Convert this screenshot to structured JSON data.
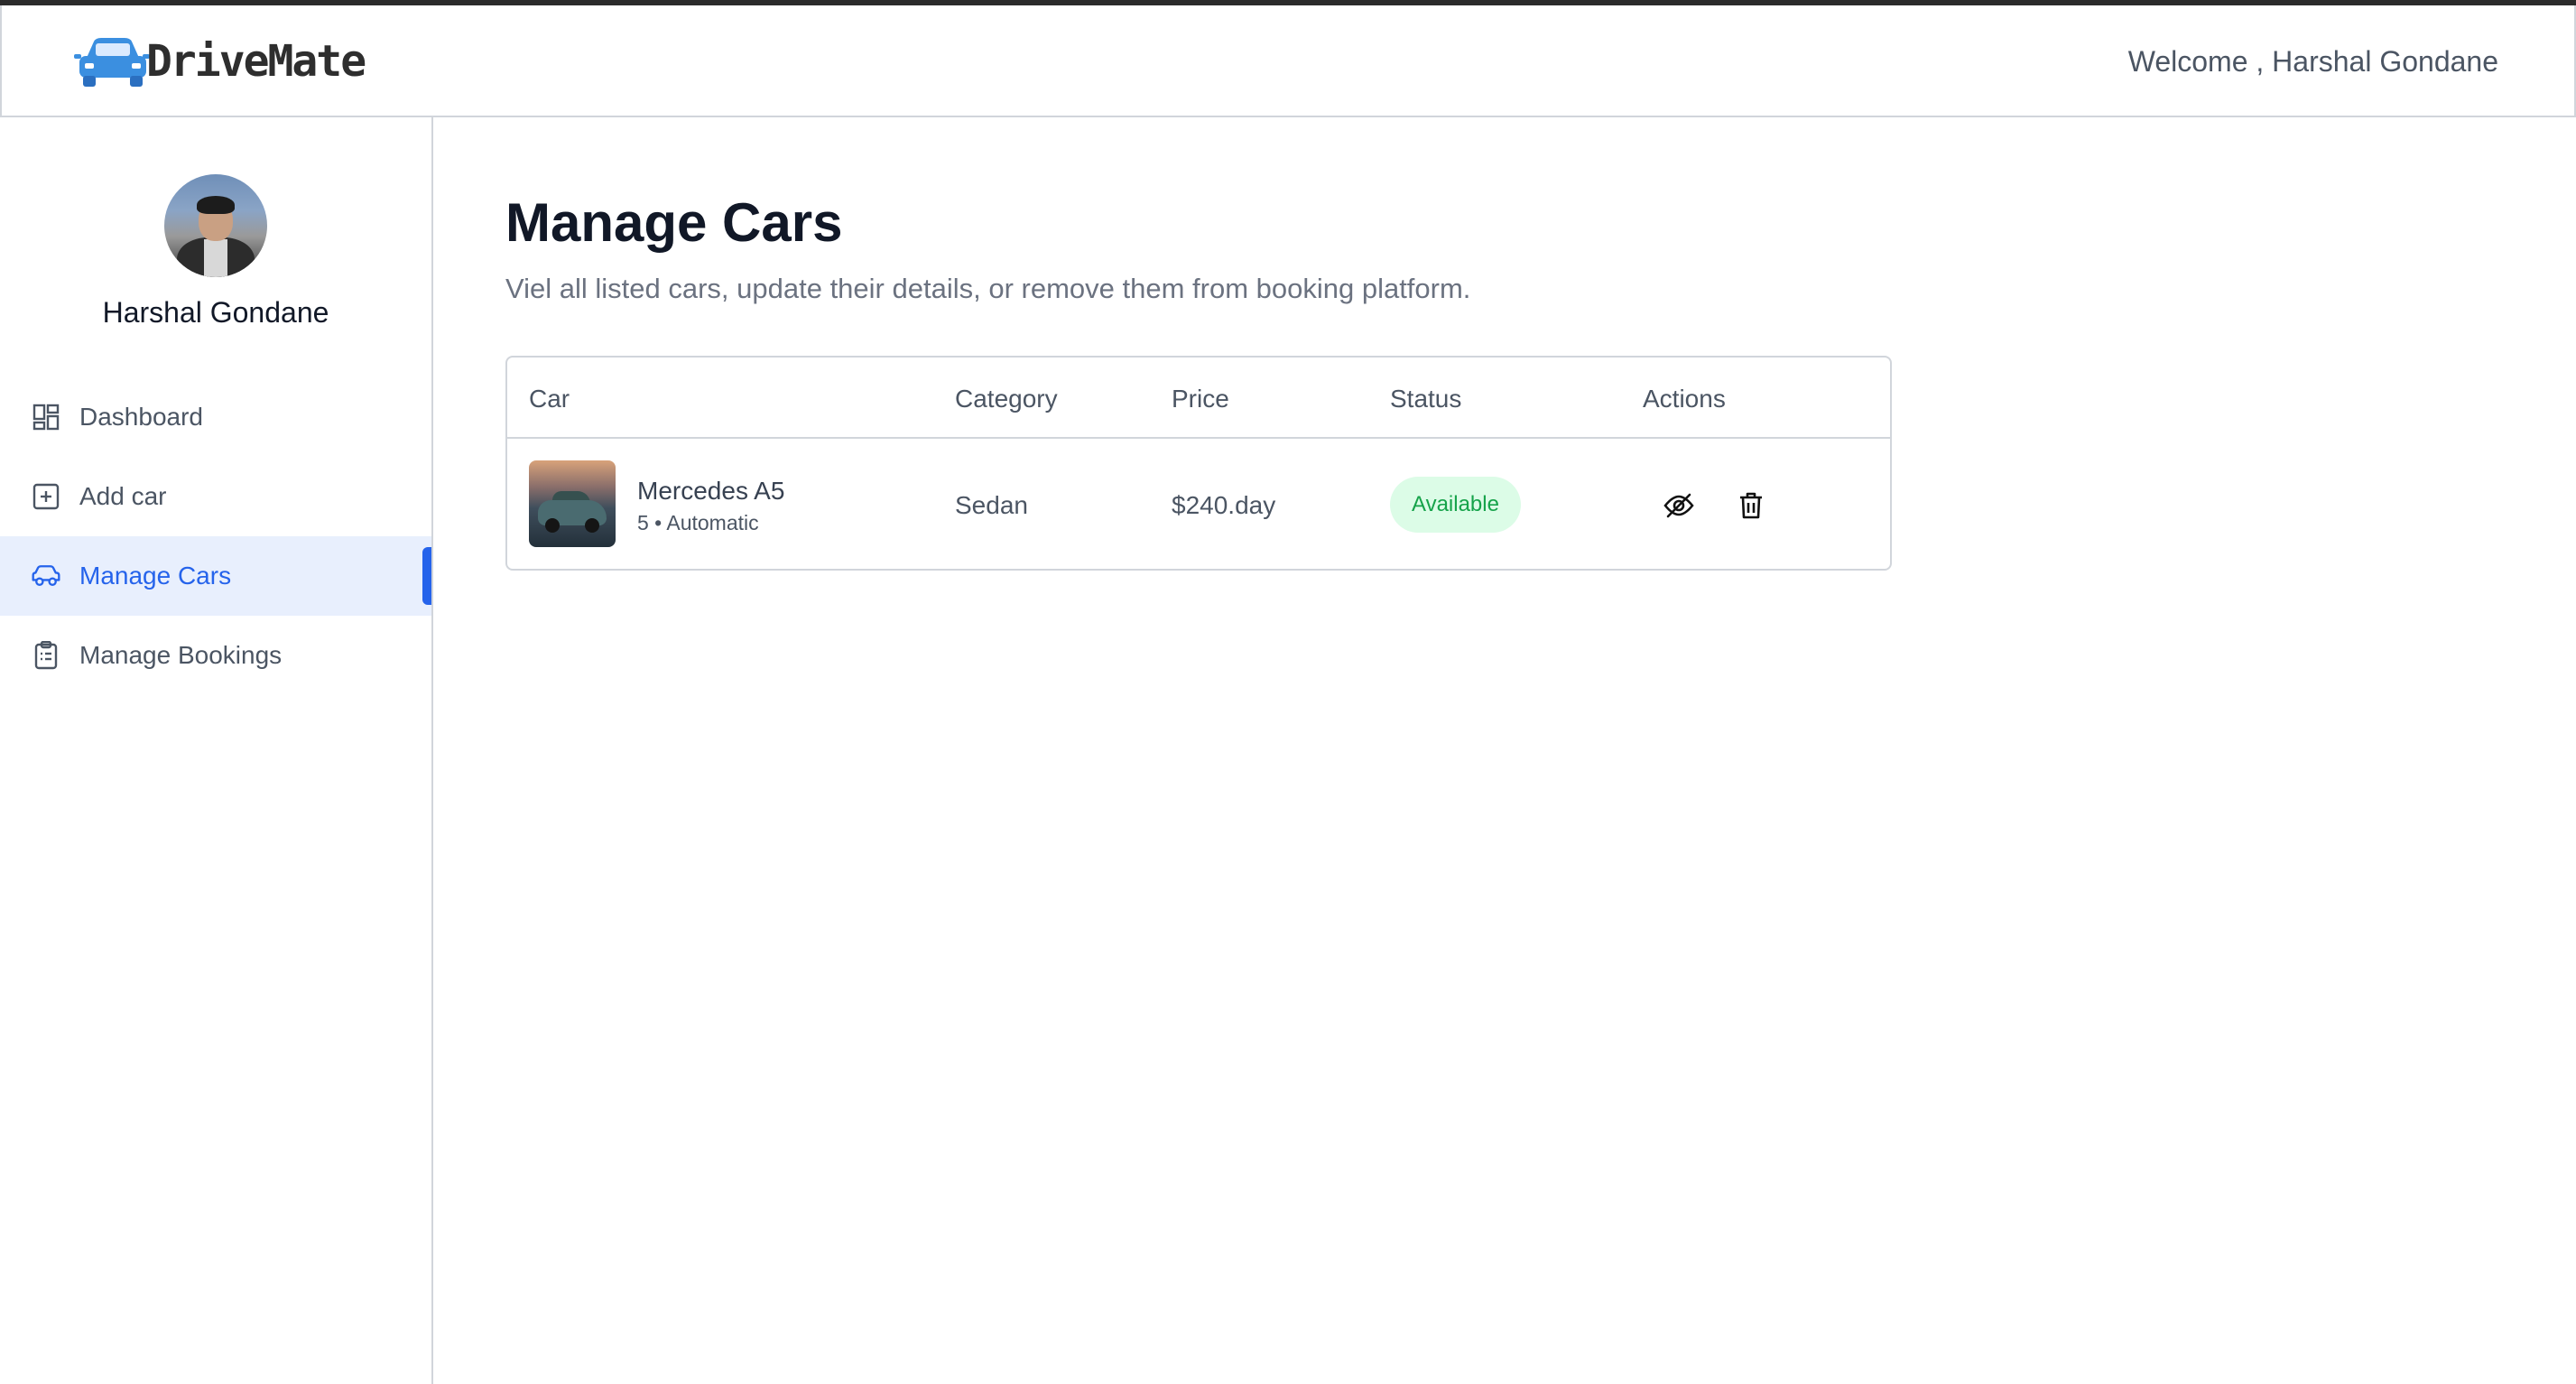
{
  "brand": {
    "name": "DriveMate",
    "accent": "#2563eb",
    "logo_color": "#3b8fe0"
  },
  "header": {
    "welcome_text": "Welcome , Harshal Gondane"
  },
  "sidebar": {
    "profile_name": "Harshal Gondane",
    "items": [
      {
        "label": "Dashboard",
        "icon": "dashboard-icon",
        "active": false
      },
      {
        "label": "Add car",
        "icon": "add-square-icon",
        "active": false
      },
      {
        "label": "Manage Cars",
        "icon": "car-icon",
        "active": true
      },
      {
        "label": "Manage Bookings",
        "icon": "clipboard-list-icon",
        "active": false
      }
    ]
  },
  "main": {
    "title": "Manage Cars",
    "subtitle": "Viel all listed cars, update their details, or remove them from booking platform.",
    "table": {
      "columns": [
        "Car",
        "Category",
        "Price",
        "Status",
        "Actions"
      ],
      "rows": [
        {
          "name": "Mercedes A5",
          "meta": "5 • Automatic",
          "category": "Sedan",
          "price": "$240.day",
          "status": "Available",
          "status_color": "#16a34a",
          "actions": [
            "eye-off-icon",
            "trash-icon"
          ]
        }
      ]
    }
  }
}
